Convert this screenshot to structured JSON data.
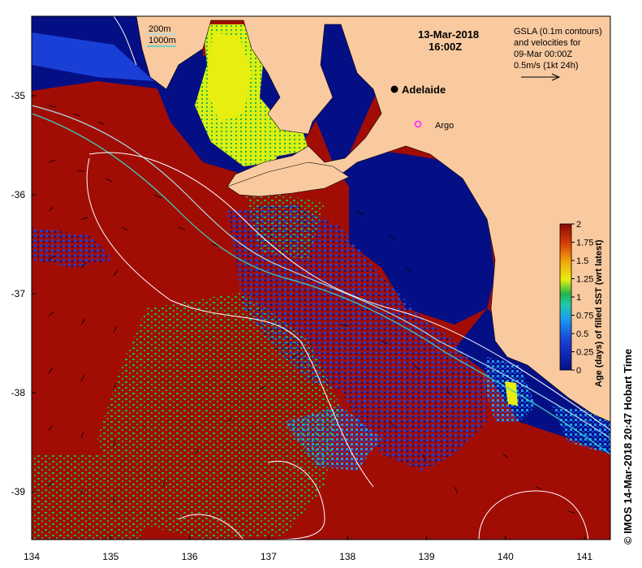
{
  "map": {
    "date": "13-Mar-2018",
    "time": "16:00Z",
    "legend_200m": "200m",
    "legend_1000m": "1000m",
    "gsla_line1": "GSLA (0.1m contours)",
    "gsla_line2": "and velocities for",
    "gsla_line3": "09-Mar 00:00Z",
    "gsla_line4": "0.5m/s (1kt 24h)",
    "place_adelaide": "Adelaide",
    "place_argo": "Argo",
    "copyright": "© IMOS 14-Mar-2018 20:47 Hobart Time",
    "colors": {
      "land": "#f9caa0",
      "warm": "#a10d05",
      "deep_blue": "#050f85",
      "mid_blue": "#1a3fd6",
      "light_blue": "#1d9bf0",
      "green": "#20b44a",
      "yellow": "#e8ef10",
      "contour": "#ffffff",
      "isobath_200": "#a9e0ee",
      "isobath_1000": "#3ad6c8",
      "argo": "#ff33ff"
    }
  },
  "axes": {
    "x_ticks": [
      "134",
      "135",
      "136",
      "137",
      "138",
      "139",
      "140",
      "141"
    ],
    "y_ticks": [
      "-35",
      "-36",
      "-37",
      "-38",
      "-39"
    ]
  },
  "colorbar": {
    "label": "Age (days) of filled SST (wrt latest)",
    "ticks": [
      "2",
      "1.75",
      "1.5",
      "1.25",
      "1",
      "0.75",
      "0.5",
      "0.25",
      "0"
    ]
  }
}
